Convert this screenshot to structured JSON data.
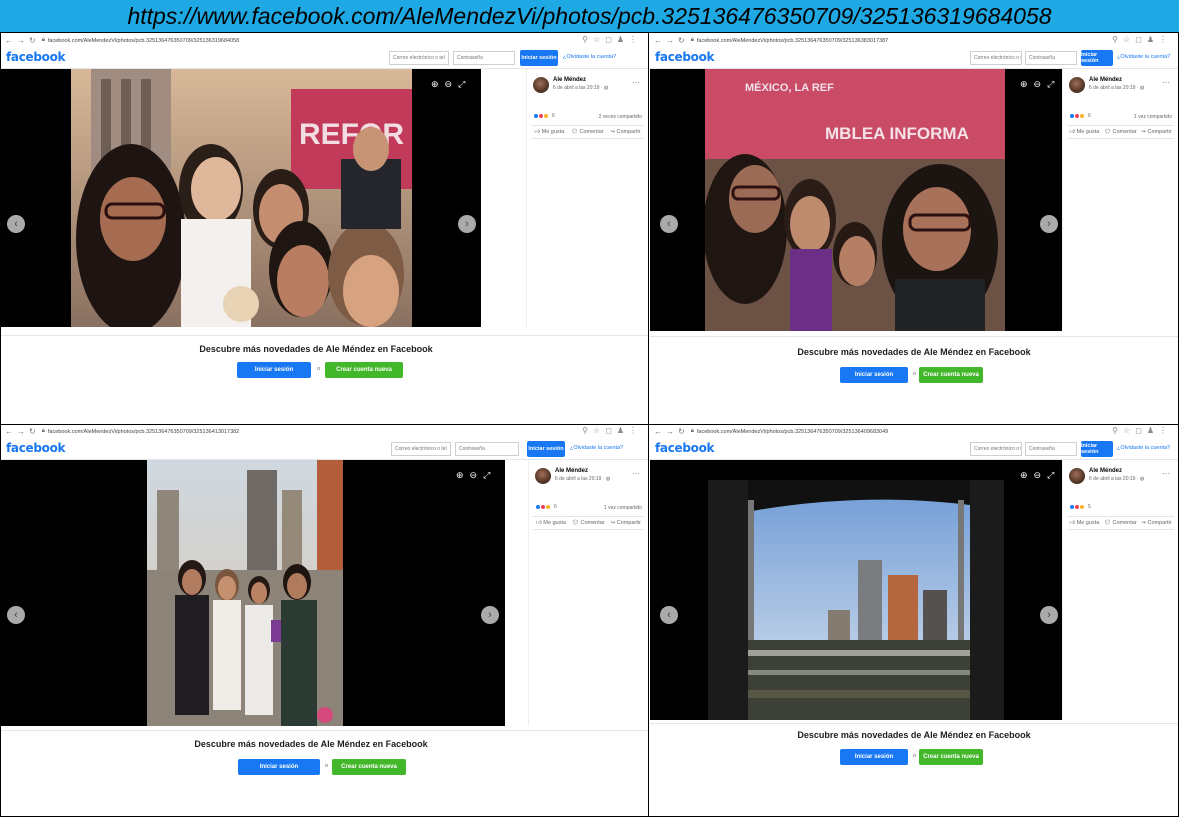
{
  "caption": "https://www.facebook.com/AleMendezVi/photos/pcb.3251364763507​09/3251363196840​58",
  "colors": {
    "fb_blue": "#1877f2",
    "fb_green": "#42b72a",
    "caption_bg": "#1fa9e4"
  },
  "panels": [
    {
      "url": "facebook.com/AleMendezVi/photos/pcb.325136476350709/3251363196840​58",
      "logo": "facebook",
      "email_placeholder": "Correo electrónico o tel",
      "password_placeholder": "Contraseña",
      "login_label": "Iniciar sesión",
      "forgot_label": "¿Olvidaste la cuenta?",
      "author": "Ale Méndez",
      "date": "6 de abril a las 20:19 · ◍",
      "reaction_count": "6",
      "shares": "2 veces compartido",
      "like_label": "Me gusta",
      "comment_label": "Comentar",
      "share_label": "Compartir",
      "discover": "Descubre más novedades de Ale Méndez en Facebook",
      "cta_login": "Iniciar sesión",
      "cta_or": "o",
      "cta_create": "Crear cuenta nueva"
    },
    {
      "url": "facebook.com/AleMendezVi/photos/pcb.325136476350709/325136383017387",
      "logo": "facebook",
      "email_placeholder": "Correo electrónico o tel",
      "password_placeholder": "Contraseña",
      "login_label": "Iniciar sesión",
      "forgot_label": "¿Olvidaste la cuenta?",
      "author": "Ale Méndez",
      "date": "6 de abril a las 20:19 · ◍",
      "reaction_count": "6",
      "shares": "1 vez compartido",
      "like_label": "Me gusta",
      "comment_label": "Comentar",
      "share_label": "Compartir",
      "discover": "Descubre más novedades de Ale Méndez en Facebook",
      "cta_login": "Iniciar sesión",
      "cta_or": "o",
      "cta_create": "Crear cuenta nueva"
    },
    {
      "url": "facebook.com/AleMendezVi/photos/pcb.325136476350709/325136413017382",
      "logo": "facebook",
      "email_placeholder": "Correo electrónico o tel",
      "password_placeholder": "Contraseña",
      "login_label": "Iniciar sesión",
      "forgot_label": "¿Olvidaste la cuenta?",
      "author": "Ale Méndez",
      "date": "6 de abril a las 20:19 · ◍",
      "reaction_count": "6",
      "shares": "1 vez compartido",
      "like_label": "Me gusta",
      "comment_label": "Comentar",
      "share_label": "Compartir",
      "discover": "Descubre más novedades de Ale Méndez en Facebook",
      "cta_login": "Iniciar sesión",
      "cta_or": "o",
      "cta_create": "Crear cuenta nueva"
    },
    {
      "url": "facebook.com/AleMendezVi/photos/pcb.325136476350709/325136409683049",
      "logo": "facebook",
      "email_placeholder": "Correo electrónico o tel",
      "password_placeholder": "Contraseña",
      "login_label": "Iniciar sesión",
      "forgot_label": "¿Olvidaste la cuenta?",
      "author": "Ale Méndez",
      "date": "6 de abril a las 20:19 · ◍",
      "reaction_count": "5",
      "shares": "",
      "like_label": "Me gusta",
      "comment_label": "Comentar",
      "share_label": "Compartir",
      "discover": "Descubre más novedades de Ale Méndez en Facebook",
      "cta_login": "Iniciar sesión",
      "cta_or": "o",
      "cta_create": "Crear cuenta nueva"
    }
  ],
  "photo_text": {
    "banner_1": "REFOR",
    "banner_2": "MÉXICO, LA REF",
    "banner_3": "MBLEA INFORMA"
  }
}
